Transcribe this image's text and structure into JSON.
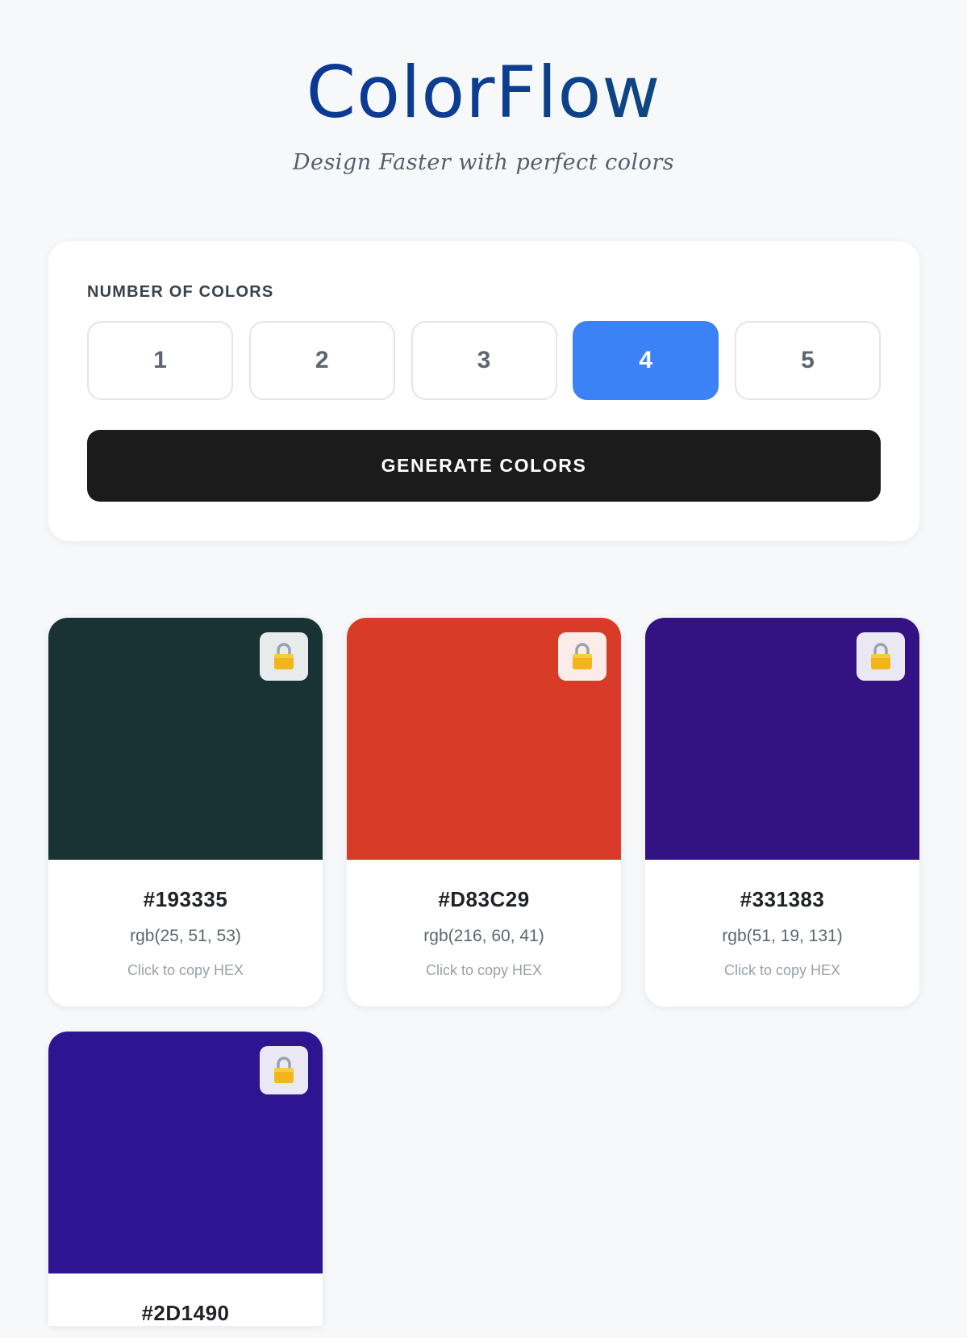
{
  "header": {
    "logo": "ColorFlow",
    "tagline": "Design Faster with perfect colors"
  },
  "controls": {
    "count_label": "NUMBER OF COLORS",
    "count_options": [
      "1",
      "2",
      "3",
      "4",
      "5"
    ],
    "selected_count": "4",
    "generate_label": "GENERATE COLORS"
  },
  "palette": [
    {
      "hex": "#193335",
      "rgb": "rgb(25, 51, 53)",
      "copy_hint": "Click to copy HEX",
      "color": "#193335",
      "lock_icon": "lock-icon"
    },
    {
      "hex": "#D83C29",
      "rgb": "rgb(216, 60, 41)",
      "copy_hint": "Click to copy HEX",
      "color": "#D83C29",
      "lock_icon": "lock-icon"
    },
    {
      "hex": "#331383",
      "rgb": "rgb(51, 19, 131)",
      "copy_hint": "Click to copy HEX",
      "color": "#331383",
      "lock_icon": "lock-icon"
    },
    {
      "hex": "#2D1490",
      "color": "#2D1490",
      "lock_icon": "lock-icon"
    }
  ],
  "colors": {
    "accent": "#3b82f6",
    "button_dark": "#1b1b1b",
    "background": "#f6f8fa"
  }
}
